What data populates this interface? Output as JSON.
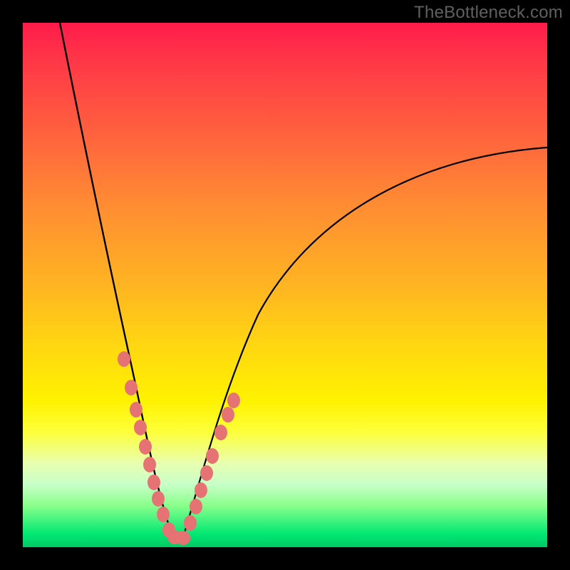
{
  "watermark": "TheBottleneck.com",
  "chart_data": {
    "type": "line",
    "title": "",
    "xlabel": "",
    "ylabel": "",
    "xlim": [
      0,
      100
    ],
    "ylim": [
      0,
      100
    ],
    "grid": false,
    "legend": false,
    "comment": "Bottleneck-style V curve: y is approx. absolute percentage deviation from an optimum at x≈28. Left branch rises steeply to ~100 at x=0; right branch rises with diminishing slope to ~76 at x=100.",
    "series": [
      {
        "name": "left-branch",
        "x": [
          7,
          10,
          13,
          16,
          18,
          20,
          22,
          24,
          26,
          28
        ],
        "y": [
          100,
          80,
          62,
          47,
          38,
          30,
          22,
          15,
          8,
          2
        ]
      },
      {
        "name": "right-branch",
        "x": [
          28,
          30,
          33,
          36,
          40,
          45,
          50,
          56,
          63,
          72,
          82,
          100
        ],
        "y": [
          2,
          6,
          13,
          20,
          28,
          36,
          43,
          50,
          57,
          64,
          70,
          76
        ]
      }
    ],
    "points": {
      "name": "sample-dots",
      "comment": "Salmon dots clustered near the minimum on both branches and at the trough.",
      "x": [
        18.5,
        20.0,
        21.0,
        21.8,
        22.7,
        23.5,
        24.3,
        25.2,
        26.2,
        27.5,
        28.0,
        29.0,
        30.0,
        31.0,
        32.0,
        33.0,
        34.0,
        35.8,
        37.2,
        38.2
      ],
      "y": [
        36.0,
        30.0,
        26.0,
        22.5,
        19.0,
        15.5,
        12.5,
        9.5,
        6.5,
        3.0,
        1.8,
        2.2,
        5.0,
        8.0,
        11.0,
        14.0,
        17.0,
        20.0,
        23.0,
        25.5
      ]
    },
    "colors": {
      "curve": "#000000",
      "dots": "#e57373",
      "gradient_top": "#ff1a4a",
      "gradient_bottom": "#00c965",
      "frame": "#000000"
    }
  }
}
